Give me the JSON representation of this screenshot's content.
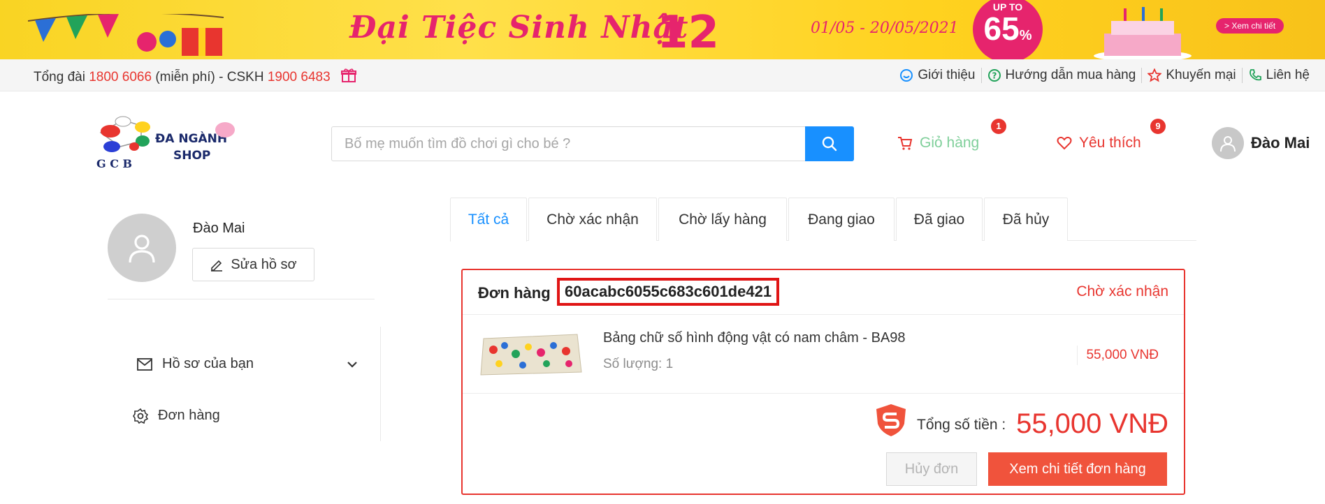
{
  "banner": {
    "title": "Đại Tiệc Sinh Nhật",
    "anniversary": "12",
    "dates": "01/05 - 20/05/2021",
    "sale_up": "UP TO",
    "sale_value": "65",
    "sale_unit": "%",
    "cta": "> Xem chi tiết"
  },
  "topbar": {
    "hotline_prefix": "Tổng đài",
    "hotline_number": "1800 6066",
    "hotline_mid": "(miễn phí) - CSKH",
    "support_number": "1900 6483",
    "links": [
      "Giới thiệu",
      "Hướng dẫn mua hàng",
      "Khuyến mại",
      "Liên hệ"
    ]
  },
  "header": {
    "logo_line1": "ĐA NGÀNH",
    "logo_line2": "SHOP",
    "logo_letters": "G C B",
    "search_placeholder": "Bố mẹ muốn tìm đồ chơi gì cho bé ?",
    "cart_label": "Giỏ hàng",
    "cart_count": "1",
    "favorites_label": "Yêu thích",
    "favorites_count": "9",
    "user_name": "Đào Mai"
  },
  "sidebar": {
    "name": "Đào Mai",
    "edit_label": "Sửa hồ sơ",
    "menu": [
      "Hồ sơ của bạn",
      "Đơn hàng"
    ]
  },
  "tabs": [
    "Tất cả",
    "Chờ xác nhận",
    "Chờ lấy hàng",
    "Đang giao",
    "Đã giao",
    "Đã hủy"
  ],
  "order": {
    "label": "Đơn hàng",
    "id": "60acabc6055c683c601de421",
    "status": "Chờ xác nhận",
    "product_name": "Bảng chữ số hình động vật có nam châm - BA98",
    "quantity_label": "Số lượng: 1",
    "price": "55,000 VNĐ",
    "total_label": "Tổng số tiền :",
    "total": "55,000 VNĐ",
    "cancel_label": "Hủy đơn",
    "detail_label": "Xem chi tiết đơn hàng"
  },
  "colors": {
    "accent_blue": "#1890ff",
    "brand_red": "#e8352f",
    "banner_yellow": "#ffd21f",
    "banner_pink": "#e6246d"
  }
}
